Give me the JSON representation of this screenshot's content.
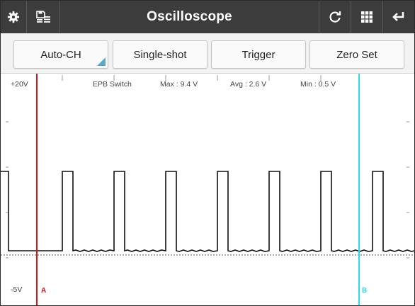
{
  "title": "Oscilloscope",
  "icons": {
    "settings": "gear-icon",
    "save": "save-list-icon",
    "refresh": "refresh-icon",
    "grid": "grid-icon",
    "back": "back-arrow-icon"
  },
  "toolbar": {
    "auto_ch": "Auto-CH",
    "single_shot": "Single-shot",
    "trigger": "Trigger",
    "zero_set": "Zero Set"
  },
  "scope": {
    "top_voltage": "+20V",
    "bottom_voltage": "-5V",
    "channel_name": "EPB Switch",
    "max": "Max : 9.4 V",
    "avg": "Avg : 2.6 V",
    "min": "Min : 0.5 V",
    "cursor_a": "A",
    "cursor_b": "B"
  },
  "colors": {
    "titlebar": "#3c3c3c",
    "cursor_a": "#d4141c",
    "cursor_b": "#2fd8ea",
    "corner_mark": "#5aa8c8"
  }
}
